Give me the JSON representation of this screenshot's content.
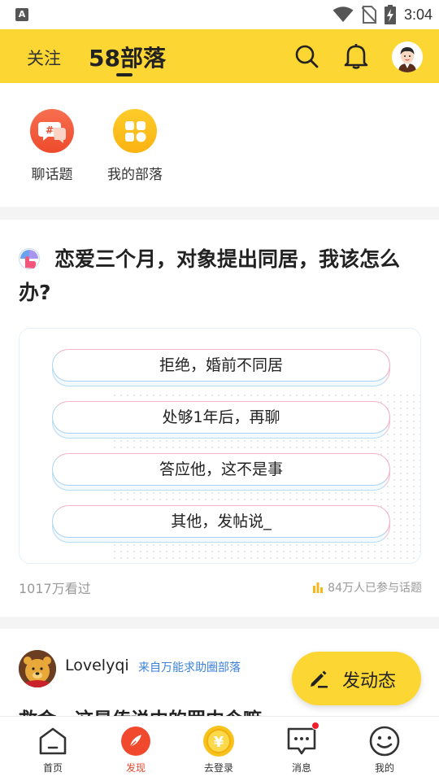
{
  "status_bar": {
    "time": "3:04",
    "left_badge": "A",
    "icons": [
      "wifi-icon",
      "no-sim-icon",
      "battery-charging-icon"
    ]
  },
  "header": {
    "tabs": [
      {
        "label": "关注",
        "active": false
      },
      {
        "label": "58部落",
        "active": true
      }
    ],
    "actions": [
      "search-icon",
      "bell-icon",
      "avatar"
    ],
    "accent_color": "#fcd632"
  },
  "shortcuts": [
    {
      "label": "聊话题",
      "icon": "chat-topic-icon",
      "color": "#f2553a"
    },
    {
      "label": "我的部落",
      "icon": "grid-apps-icon",
      "color": "#fcb717"
    }
  ],
  "topic_card": {
    "title": "恋爱三个月，对象提出同居，我该怎么办?",
    "options": [
      "拒绝，婚前不同居",
      "处够1年后，再聊",
      "答应他，这不是事",
      "其他，发帖说_"
    ],
    "views": "1017万看过",
    "participants": "84万人已参与话题"
  },
  "post": {
    "username": "Lovelyqi",
    "source": "来自万能求助圈部落",
    "text_preview": "救命，这是传说中的罢中令嘛"
  },
  "fab": {
    "label": "发动态",
    "icon": "pencil-icon"
  },
  "bottom_nav": [
    {
      "label": "首页",
      "icon": "home-icon",
      "active": false
    },
    {
      "label": "发现",
      "icon": "discover-icon",
      "active": true
    },
    {
      "label": "去登录",
      "icon": "coin-icon",
      "active": false
    },
    {
      "label": "消息",
      "icon": "message-icon",
      "active": false,
      "badge": true
    },
    {
      "label": "我的",
      "icon": "smiley-icon",
      "active": false
    }
  ]
}
